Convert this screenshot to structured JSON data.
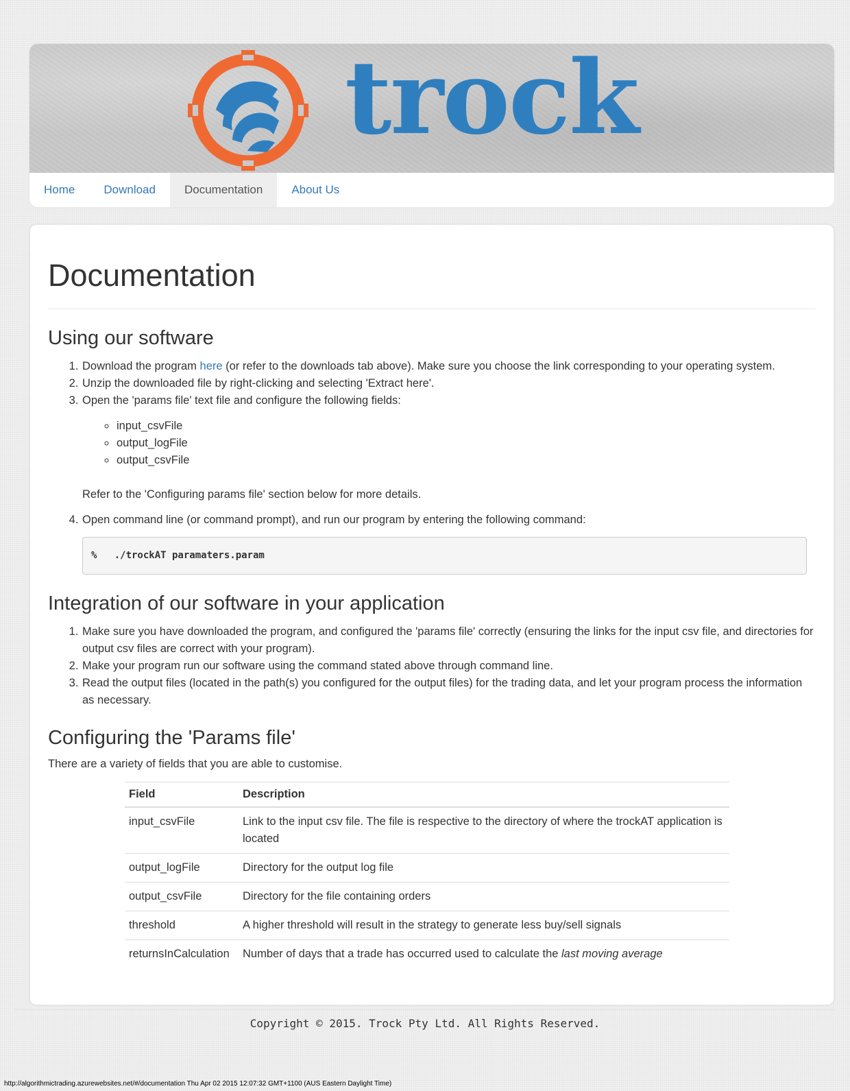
{
  "brand": {
    "name": "trock",
    "logo_icon": "trock-logo-icon",
    "colors": {
      "ring": "#ef6a32",
      "text": "#2f7fbf"
    }
  },
  "nav": {
    "items": [
      {
        "label": "Home",
        "active": false
      },
      {
        "label": "Download",
        "active": false
      },
      {
        "label": "Documentation",
        "active": true
      },
      {
        "label": "About Us",
        "active": false
      }
    ]
  },
  "page_title": "Documentation",
  "sections": {
    "using": {
      "title": "Using our software",
      "step1_pre": "Download the program ",
      "step1_link": "here",
      "step1_post": " (or refer to the downloads tab above). Make sure you choose the link corresponding to your operating system.",
      "step2": "Unzip the downloaded file by right-clicking and selecting 'Extract here'.",
      "step3": "Open the 'params file' text file and configure the following fields:",
      "step3_fields": [
        "input_csvFile",
        "output_logFile",
        "output_csvFile"
      ],
      "step3_refer": "Refer to the 'Configuring params file' section below for more details.",
      "step4": "Open command line (or command prompt), and run our program by entering the following command:",
      "command": "%   ./trockAT paramaters.param"
    },
    "integration": {
      "title": "Integration of our software in your application",
      "steps": [
        "Make sure you have downloaded the program, and configured the 'params file' correctly (ensuring the links for the input csv file, and directories for output csv files are correct with your program).",
        "Make your program run our software using the command stated above through command line.",
        "Read the output files (located in the path(s) you configured for the output files) for the trading data, and let your program process the information as necessary."
      ]
    },
    "config": {
      "title": "Configuring the 'Params file'",
      "intro": "There are a variety of fields that you are able to customise.",
      "table": {
        "headers": [
          "Field",
          "Description"
        ],
        "rows": [
          {
            "field": "input_csvFile",
            "desc": "Link to the input csv file. The file is respective to the directory of where the trockAT application is located"
          },
          {
            "field": "output_logFile",
            "desc": "Directory for the output log file"
          },
          {
            "field": "output_csvFile",
            "desc": "Directory for the file containing orders"
          },
          {
            "field": "threshold",
            "desc": "A higher threshold will result in the strategy to generate less buy/sell signals"
          },
          {
            "field": "returnsInCalculation",
            "desc": "Number of days that a trade has occurred used to calculate the ",
            "desc_em": "last moving average"
          }
        ]
      }
    }
  },
  "footer": "Copyright © 2015. Trock Pty Ltd. All Rights Reserved.",
  "statusbar": "http://algorithmictrading.azurewebsites.net/#/documentation Thu Apr 02 2015 12:07:32 GMT+1100 (AUS Eastern Daylight Time)"
}
